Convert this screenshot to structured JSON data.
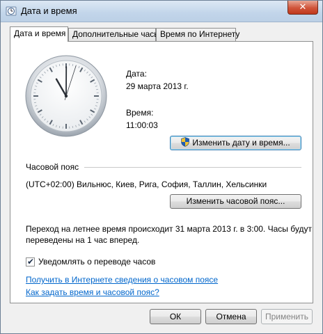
{
  "window": {
    "title": "Дата и время",
    "close_glyph": "✕"
  },
  "tabs": [
    {
      "label": "Дата и время",
      "active": true
    },
    {
      "label": "Дополнительные часы",
      "active": false
    },
    {
      "label": "Время по Интернету",
      "active": false
    }
  ],
  "datetime": {
    "date_label": "Дата:",
    "date_value": "29 марта 2013 г.",
    "time_label": "Время:",
    "time_value": "11:00:03",
    "change_button": "Изменить дату и время..."
  },
  "clock": {
    "hours": 11,
    "minutes": 0,
    "seconds": 3
  },
  "timezone": {
    "heading": "Часовой пояс",
    "value": "(UTC+02:00) Вильнюс, Киев, Рига, София, Таллин, Хельсинки",
    "change_button": "Изменить часовой пояс..."
  },
  "dst": {
    "line1": "Переход на летнее время происходит 31 марта 2013 г. в 3:00. Часы будут",
    "line2": "переведены на 1 час вперед."
  },
  "notify": {
    "label": "Уведомлять о переводе часов",
    "checked": true,
    "check_glyph": "✔"
  },
  "links": {
    "online_info": "Получить в Интернете сведения о часовом поясе",
    "how_to": "Как задать время и часовой пояс?"
  },
  "footer": {
    "ok": "ОК",
    "cancel": "Отмена",
    "apply": "Применить"
  },
  "icons": {
    "title": "clock-window-icon",
    "close": "close-icon",
    "shield": "uac-shield-icon"
  }
}
